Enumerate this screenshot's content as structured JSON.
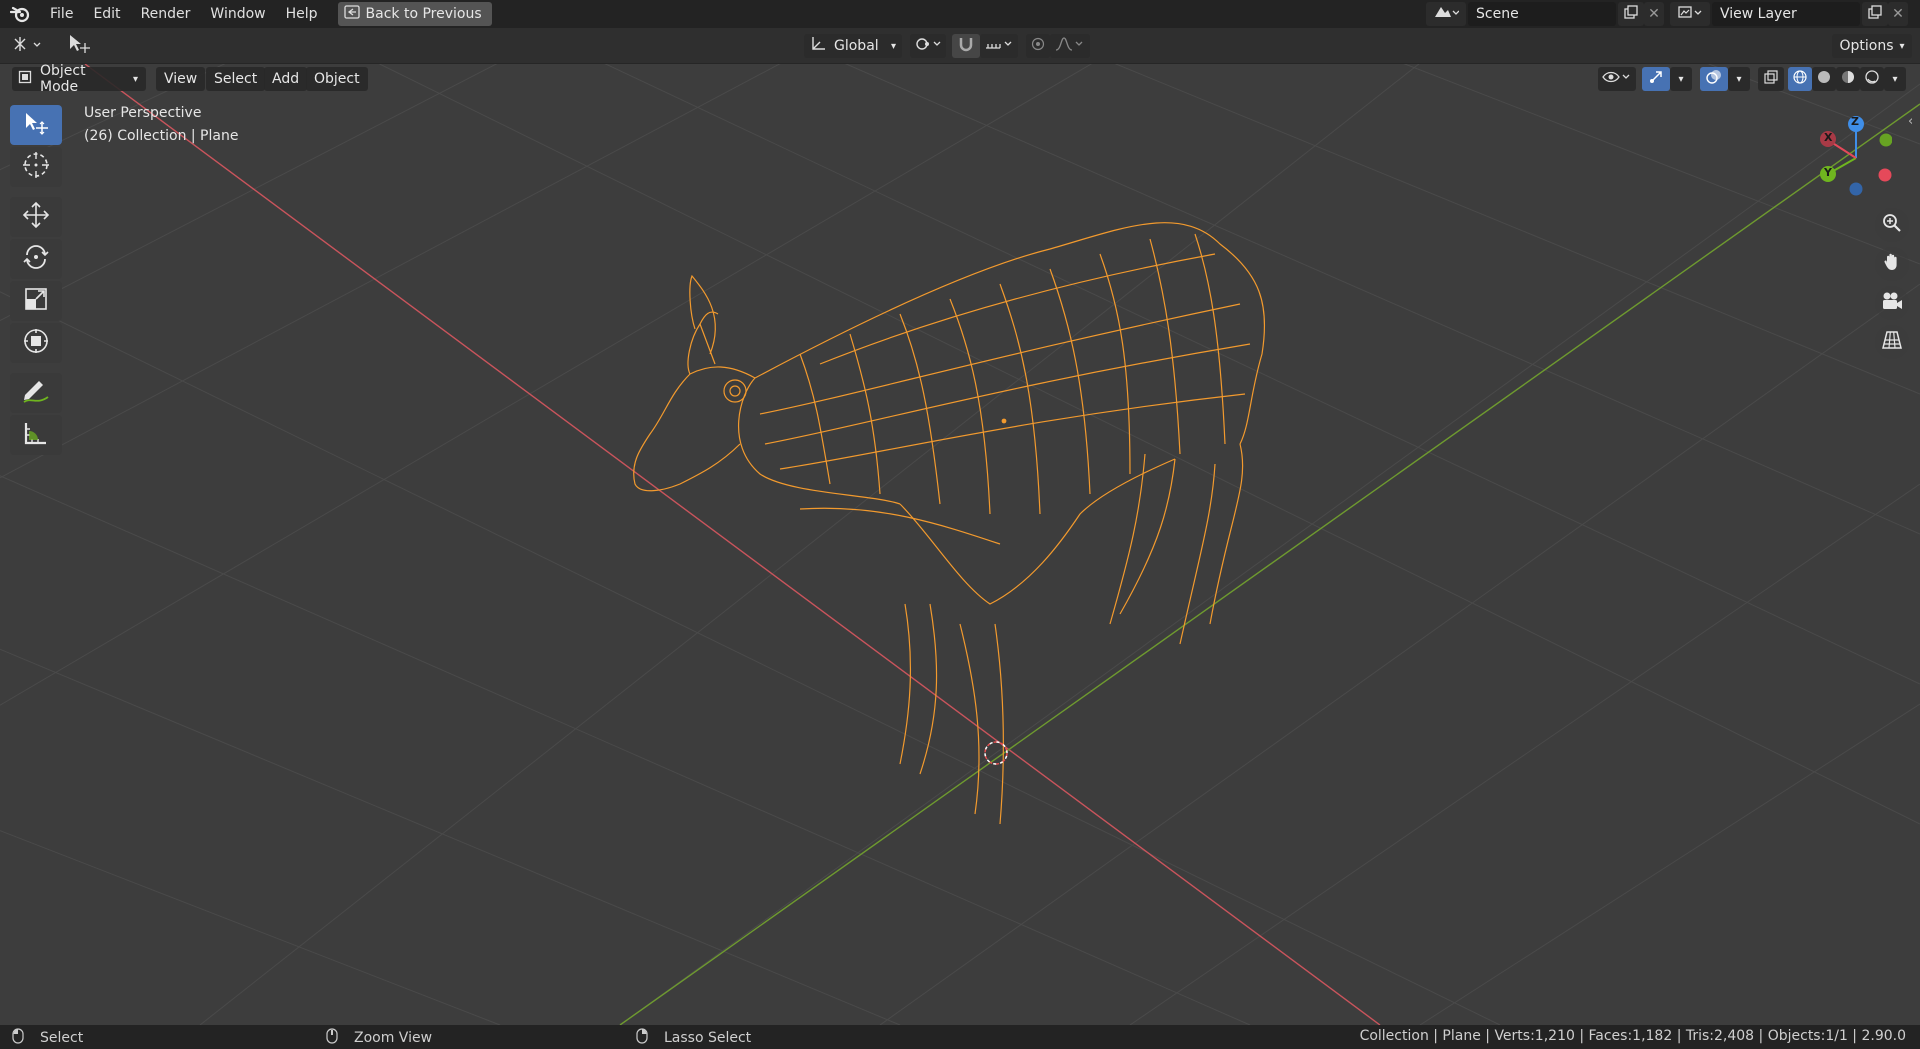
{
  "topbar": {
    "menus": [
      "File",
      "Edit",
      "Render",
      "Window",
      "Help"
    ],
    "back_button": "Back to Previous",
    "scene": "Scene",
    "view_layer": "View Layer"
  },
  "toolheader": {
    "transform_orientation": "Global",
    "options_label": "Options"
  },
  "viewport_header": {
    "mode": "Object Mode",
    "menus": [
      "View",
      "Select",
      "Add",
      "Object"
    ]
  },
  "viewport": {
    "perspective_label": "User Perspective",
    "collection_label": "(26) Collection | Plane"
  },
  "gizmo": {
    "x_label": "X",
    "y_label": "Y",
    "z_label": "Z",
    "x_color": "#e5495a",
    "y_color": "#6fb51f",
    "z_color": "#3f8ee8"
  },
  "statusbar": {
    "left_action": "Select",
    "middle_action": "Zoom View",
    "right_action": "Lasso Select",
    "stats": "Collection | Plane | Verts:1,210 | Faces:1,182 | Tris:2,408 | Objects:1/1 | 2.90.0"
  },
  "colors": {
    "wireframe": "#f29a2e",
    "x_axis": "#c9545c",
    "y_axis": "#6e9a2f",
    "accent": "#4772b3"
  }
}
